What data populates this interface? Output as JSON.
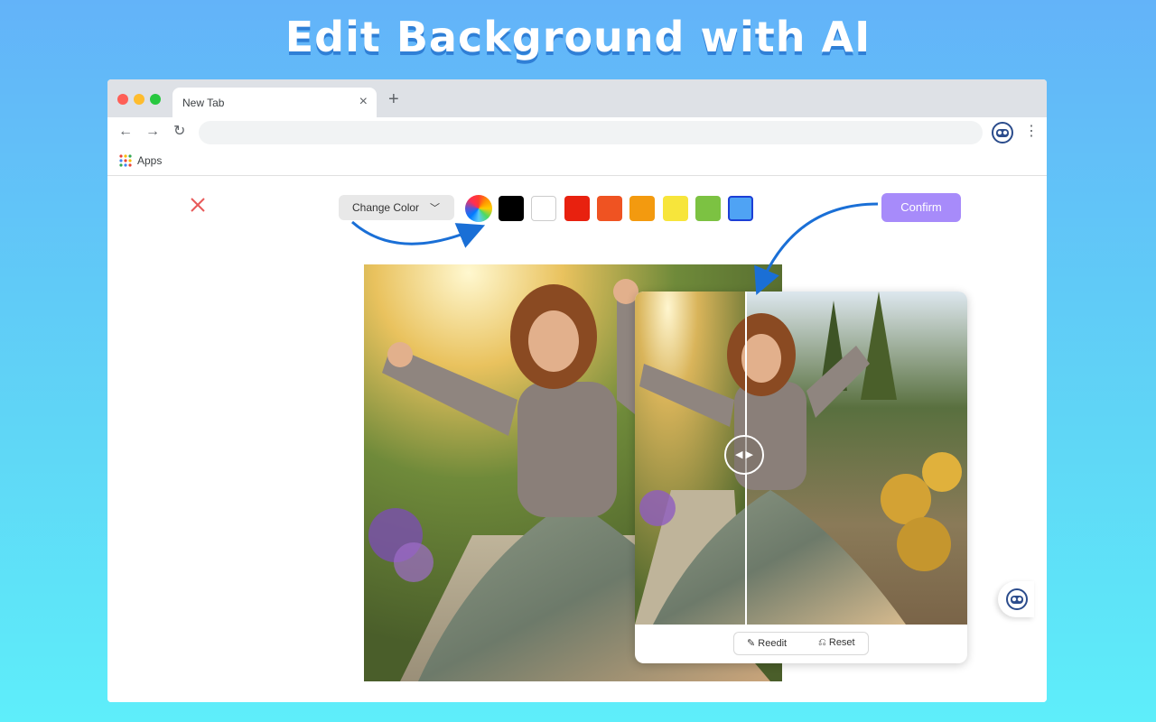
{
  "headline": "Edit Background with AI",
  "browser": {
    "tab_title": "New Tab",
    "new_tab": "+",
    "close_tab": "×",
    "bookmark_apps": "Apps"
  },
  "editor": {
    "change_color_label": "Change Color",
    "confirm_label": "Confirm",
    "swatches": [
      "#000000",
      "#ffffff",
      "#e8210f",
      "#ef5322",
      "#f39a0f",
      "#f7e53b",
      "#7cc242",
      "#4fa3f4"
    ],
    "selected_swatch": "#4fa3f4",
    "reedit_label": "Reedit",
    "reset_label": "Reset"
  },
  "colors": {
    "accent_purple": "#a78bfa",
    "arrow_blue": "#1a6fd6"
  }
}
